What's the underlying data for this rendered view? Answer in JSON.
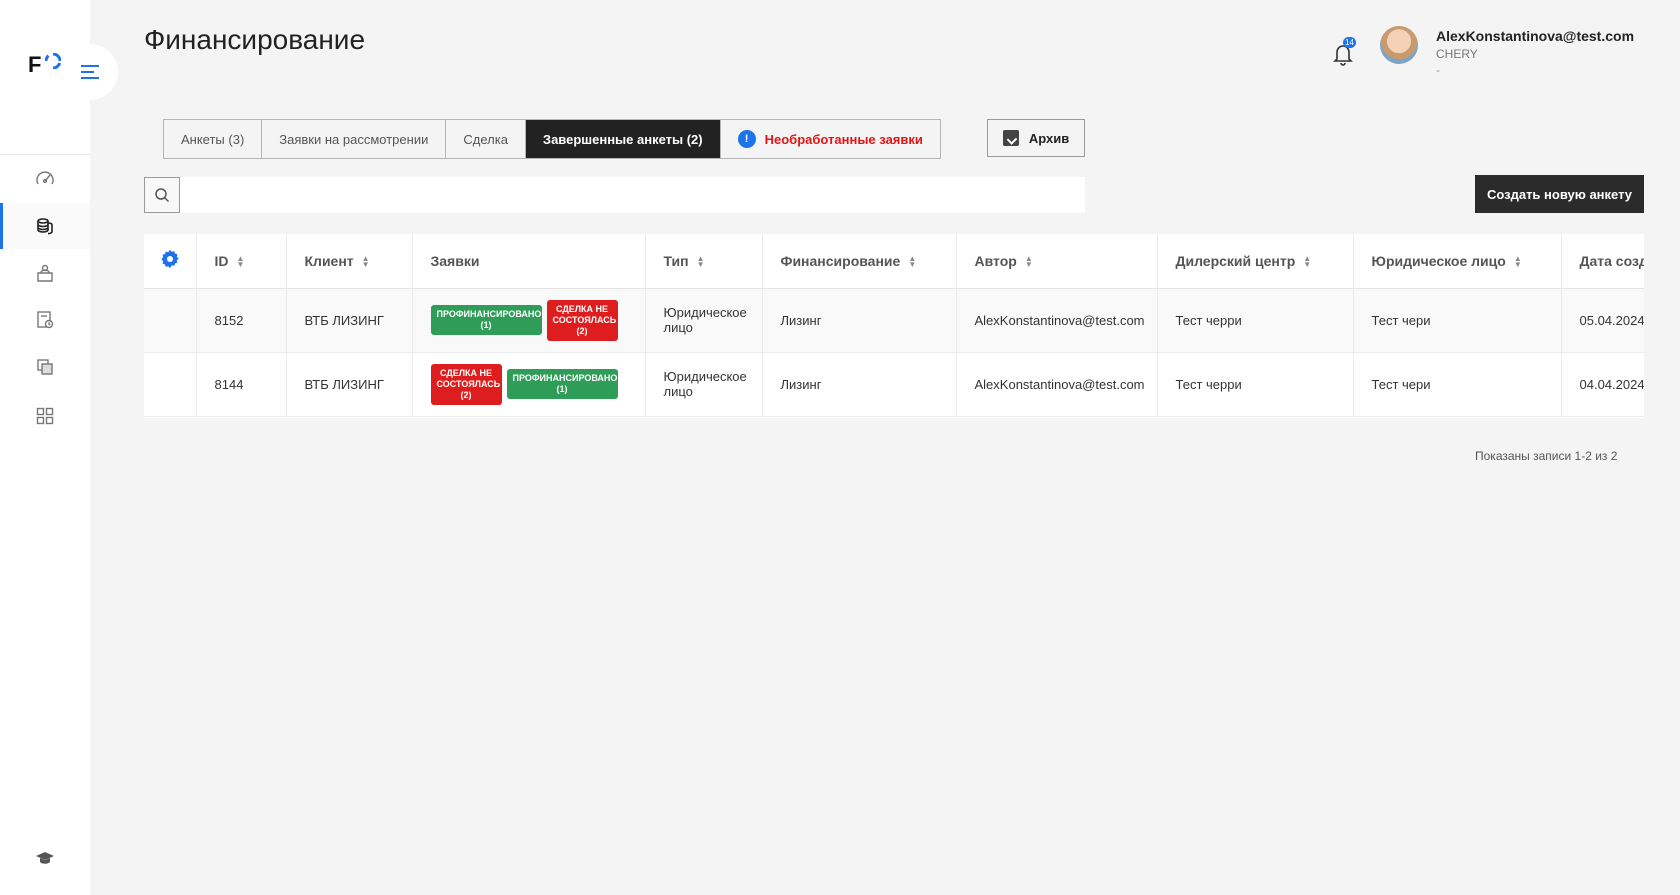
{
  "app": {
    "logo_text": "F"
  },
  "header": {
    "title": "Финансирование",
    "notifications_count": "14",
    "user_email": "AlexKonstantinova@test.com",
    "user_org": "CHERY",
    "user_extra": "-"
  },
  "sidebar": {
    "items": [
      {
        "icon": "dashboard-icon"
      },
      {
        "icon": "coins-icon",
        "active": true
      },
      {
        "icon": "person-document-icon"
      },
      {
        "icon": "schedule-document-icon"
      },
      {
        "icon": "copies-icon"
      },
      {
        "icon": "grid-icon"
      }
    ],
    "bottom_icon": "graduation-cap-icon"
  },
  "tabs": [
    {
      "label": "Анкеты (3)"
    },
    {
      "label": "Заявки на рассмотрении"
    },
    {
      "label": "Сделка"
    },
    {
      "label": "Завершенные анкеты (2)",
      "active": true
    },
    {
      "label": "Необработанные заявки",
      "alert": true,
      "alert_mark": "!"
    }
  ],
  "archive_button": "Архив",
  "search": {
    "value": "",
    "placeholder": ""
  },
  "create_button": "Создать новую анкету",
  "table": {
    "columns": [
      "ID",
      "Клиент",
      "Заявки",
      "Тип",
      "Финансирование",
      "Автор",
      "Дилерский центр",
      "Юридическое лицо",
      "Дата созд"
    ],
    "rows": [
      {
        "id": "8152",
        "client": "ВТБ ЛИЗИНГ",
        "badges": [
          {
            "text": "ПРОФИНАНСИРОВАНО (1)",
            "color": "green"
          },
          {
            "text": "СДЕЛКА НЕ СОСТОЯЛАСЬ (2)",
            "color": "red"
          }
        ],
        "type": "Юридическое лицо",
        "financing": "Лизинг",
        "author": "AlexKonstantinova@test.com",
        "dealer": "Тест черри",
        "legal_entity": "Тест чери",
        "date": "05.04.2024"
      },
      {
        "id": "8144",
        "client": "ВТБ ЛИЗИНГ",
        "badges": [
          {
            "text": "СДЕЛКА НЕ СОСТОЯЛАСЬ (2)",
            "color": "red"
          },
          {
            "text": "ПРОФИНАНСИРОВАНО (1)",
            "color": "green"
          }
        ],
        "type": "Юридическое лицо",
        "financing": "Лизинг",
        "author": "AlexKonstantinova@test.com",
        "dealer": "Тест черри",
        "legal_entity": "Тест чери",
        "date": "04.04.2024"
      }
    ]
  },
  "records_info": "Показаны записи 1-2 из 2",
  "colors": {
    "accent": "#1e73e8",
    "alert": "#e01515",
    "badge_green": "#2f9c58",
    "badge_red": "#de1e1e",
    "dark_button": "#2b2b2b"
  }
}
